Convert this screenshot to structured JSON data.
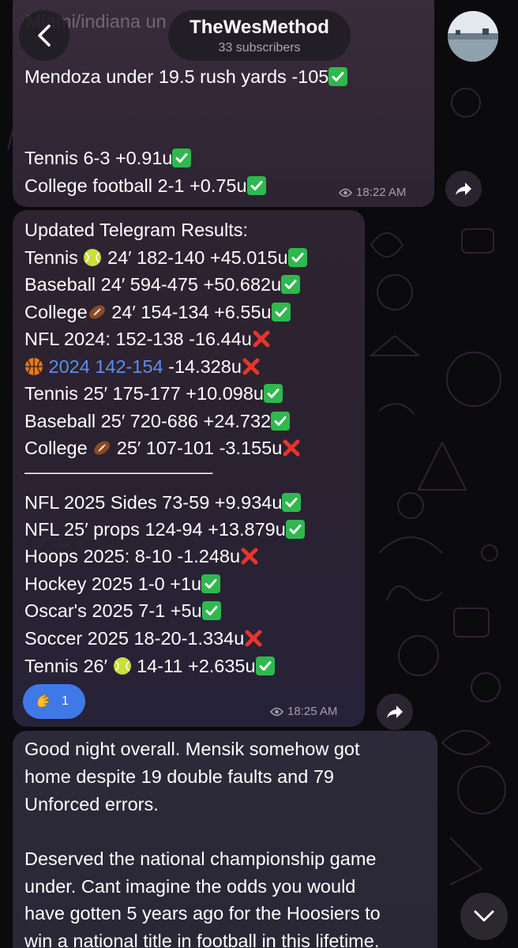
{
  "header": {
    "channel_name": "TheWesMethod",
    "subscribers": "33 subscribers",
    "back_icon": "chevron-left-icon",
    "avatar_icon": "channel-avatar"
  },
  "message1": {
    "partial_top": "Miami/indiana un",
    "lines": [
      "Mendoza under 19.5 rush yards -105",
      "Tennis 6-3 +0.91u",
      "College football 2-1 +0.75u"
    ],
    "time": "18:22 AM"
  },
  "message2": {
    "title": "Updated Telegram Results:",
    "lines": [
      {
        "pre": "Tennis ",
        "post": " 24′ 182-140 +45.015u"
      },
      {
        "pre": "Baseball 24′ 594-475 +50.682u",
        "post": ""
      },
      {
        "pre": "College",
        "post": " 24′ 154-134 +6.55u"
      },
      {
        "pre": "NFL 2024: 152-138 -16.44u",
        "post": ""
      },
      {
        "link": "2024 142-154",
        "post": " -14.328u"
      },
      {
        "pre": "Tennis 25′ 175-177 +10.098u",
        "post": ""
      },
      {
        "pre": "Baseball 25′ 720-686 +24.732",
        "post": ""
      },
      {
        "pre": "College ",
        "post": " 25′ 107-101 -3.155u"
      },
      {
        "pre": "———————————",
        "post": ""
      },
      {
        "pre": "NFL 2025 Sides 73-59 +9.934u",
        "post": ""
      },
      {
        "pre": "NFL 25′ props 124-94 +13.879u",
        "post": ""
      },
      {
        "pre": "Hoops 2025: 8-10 -1.248u",
        "post": ""
      },
      {
        "pre": "Hockey 2025 1-0 +1u",
        "post": ""
      },
      {
        "pre": "Oscar's 2025 7-1 +5u",
        "post": ""
      },
      {
        "pre": "Soccer 2025 18-20-1.334u",
        "post": ""
      },
      {
        "pre": "Tennis 26′ ",
        "post": " 14-11 +2.635u"
      }
    ],
    "reaction": {
      "emoji": "clapping-hands-icon",
      "count": "1"
    },
    "time": "18:25 AM"
  },
  "message3": {
    "lines": [
      "Good night overall.  Mensik somehow got",
      "home despite 19 double faults and 79",
      "Unforced errors.",
      "",
      "Deserved the national championship game",
      "under. Cant imagine the odds you would",
      "have gotten 5 years ago for the Hoosiers to",
      "win a national title in football in this lifetime."
    ]
  },
  "colors": {
    "background": "#0b0a0d",
    "bubble": "#2a2232",
    "link": "#5a8ff0",
    "reaction": "#3f79e8",
    "check": "#2fb84e",
    "cross": "#e8342c"
  }
}
